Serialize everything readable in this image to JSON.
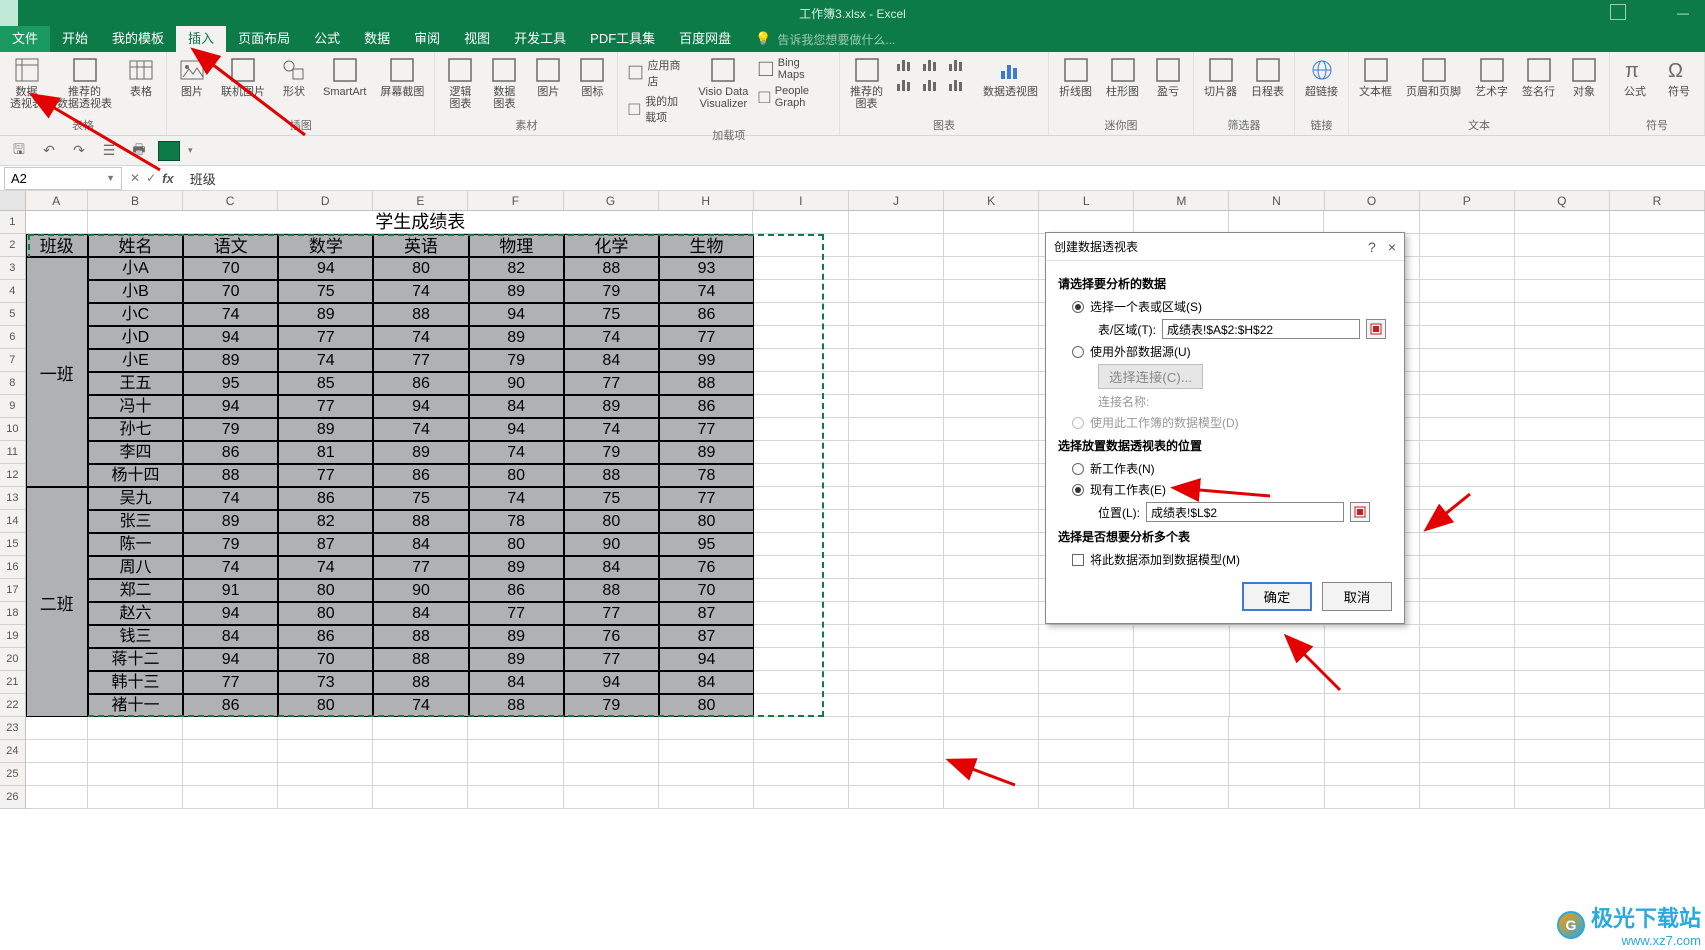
{
  "title_bar": {
    "doc": "工作簿3.xlsx - Excel"
  },
  "tabs": {
    "file": "文件",
    "items": [
      "开始",
      "我的模板",
      "插入",
      "页面布局",
      "公式",
      "数据",
      "审阅",
      "视图",
      "开发工具",
      "PDF工具集",
      "百度网盘"
    ],
    "active_index": 2,
    "tell_me": "告诉我您想要做什么..."
  },
  "ribbon": {
    "groups": [
      {
        "name": "表格",
        "btns": [
          {
            "label": "数据\n透视表",
            "icon": "pivot-table-icon"
          },
          {
            "label": "推荐的\n数据透视表",
            "icon": "recommended-pivot-icon"
          },
          {
            "label": "表格",
            "icon": "table-icon"
          }
        ]
      },
      {
        "name": "插图",
        "btns": [
          {
            "label": "图片",
            "icon": "picture-icon"
          },
          {
            "label": "联机图片",
            "icon": "online-picture-icon"
          },
          {
            "label": "形状",
            "icon": "shapes-icon"
          },
          {
            "label": "SmartArt",
            "icon": "smartart-icon"
          },
          {
            "label": "屏幕截图",
            "icon": "screenshot-icon"
          }
        ]
      },
      {
        "name": "素材",
        "btns": [
          {
            "label": "逻辑\n图表",
            "icon": "logic-chart-icon"
          },
          {
            "label": "数据\n图表",
            "icon": "data-chart-icon"
          },
          {
            "label": "图片",
            "icon": "pictures-icon"
          },
          {
            "label": "图标",
            "icon": "icons-icon"
          }
        ]
      },
      {
        "name": "加载项",
        "stack": [
          {
            "label": "应用商店",
            "icon": "store-icon"
          },
          {
            "label": "我的加载项",
            "icon": "addins-icon"
          }
        ],
        "btns": [
          {
            "label": "Visio Data\nVisualizer",
            "icon": "visio-icon"
          },
          {
            "label": "Bing Maps",
            "icon": "bing-maps-icon",
            "stackmode": true
          },
          {
            "label": "People Graph",
            "icon": "people-graph-icon",
            "stackmode": true
          }
        ]
      },
      {
        "name": "图表",
        "btns": [
          {
            "label": "推荐的\n图表",
            "icon": "recommended-chart-icon"
          },
          {
            "label": "",
            "icon": "chart-gallery-icon",
            "gallery": true
          },
          {
            "label": "数据透视图",
            "icon": "pivot-chart-icon"
          }
        ]
      },
      {
        "name": "迷你图",
        "btns": [
          {
            "label": "折线图",
            "icon": "sparkline-line-icon"
          },
          {
            "label": "柱形图",
            "icon": "sparkline-column-icon"
          },
          {
            "label": "盈亏",
            "icon": "sparkline-winloss-icon"
          }
        ]
      },
      {
        "name": "筛选器",
        "btns": [
          {
            "label": "切片器",
            "icon": "slicer-icon"
          },
          {
            "label": "日程表",
            "icon": "timeline-icon"
          }
        ]
      },
      {
        "name": "链接",
        "btns": [
          {
            "label": "超链接",
            "icon": "hyperlink-icon"
          }
        ]
      },
      {
        "name": "文本",
        "btns": [
          {
            "label": "文本框",
            "icon": "textbox-icon"
          },
          {
            "label": "页眉和页脚",
            "icon": "header-footer-icon"
          },
          {
            "label": "艺术字",
            "icon": "wordart-icon"
          },
          {
            "label": "签名行",
            "icon": "signature-icon"
          },
          {
            "label": "对象",
            "icon": "object-icon"
          }
        ]
      },
      {
        "name": "符号",
        "btns": [
          {
            "label": "公式",
            "icon": "equation-icon"
          },
          {
            "label": "符号",
            "icon": "symbol-icon"
          }
        ]
      }
    ]
  },
  "namebox": "A2",
  "formula": "班级",
  "columns": [
    "A",
    "B",
    "C",
    "D",
    "E",
    "F",
    "G",
    "H",
    "I",
    "J",
    "K",
    "L",
    "M",
    "N",
    "O",
    "P"
  ],
  "extra_cols": [
    "P",
    "Q",
    "R"
  ],
  "table": {
    "title": "学生成绩表",
    "headers": [
      "班级",
      "姓名",
      "语文",
      "数学",
      "英语",
      "物理",
      "化学",
      "生物"
    ],
    "class_merge": [
      {
        "label": "一班",
        "rows": 10
      },
      {
        "label": "二班",
        "rows": 10
      }
    ],
    "rows": [
      [
        "小A",
        "70",
        "94",
        "80",
        "82",
        "88",
        "93"
      ],
      [
        "小B",
        "70",
        "75",
        "74",
        "89",
        "79",
        "74"
      ],
      [
        "小C",
        "74",
        "89",
        "88",
        "94",
        "75",
        "86"
      ],
      [
        "小D",
        "94",
        "77",
        "74",
        "89",
        "74",
        "77"
      ],
      [
        "小E",
        "89",
        "74",
        "77",
        "79",
        "84",
        "99"
      ],
      [
        "王五",
        "95",
        "85",
        "86",
        "90",
        "77",
        "88"
      ],
      [
        "冯十",
        "94",
        "77",
        "94",
        "84",
        "89",
        "86"
      ],
      [
        "孙七",
        "79",
        "89",
        "74",
        "94",
        "74",
        "77"
      ],
      [
        "李四",
        "86",
        "81",
        "89",
        "74",
        "79",
        "89"
      ],
      [
        "杨十四",
        "88",
        "77",
        "86",
        "80",
        "88",
        "78"
      ],
      [
        "吴九",
        "74",
        "86",
        "75",
        "74",
        "75",
        "77"
      ],
      [
        "张三",
        "89",
        "82",
        "88",
        "78",
        "80",
        "80"
      ],
      [
        "陈一",
        "79",
        "87",
        "84",
        "80",
        "90",
        "95"
      ],
      [
        "周八",
        "74",
        "74",
        "77",
        "89",
        "84",
        "76"
      ],
      [
        "郑二",
        "91",
        "80",
        "90",
        "86",
        "88",
        "70"
      ],
      [
        "赵六",
        "94",
        "80",
        "84",
        "77",
        "77",
        "87"
      ],
      [
        "钱三",
        "84",
        "86",
        "88",
        "89",
        "76",
        "87"
      ],
      [
        "蒋十二",
        "94",
        "70",
        "88",
        "89",
        "77",
        "94"
      ],
      [
        "韩十三",
        "77",
        "73",
        "88",
        "84",
        "94",
        "84"
      ],
      [
        "褚十一",
        "86",
        "80",
        "74",
        "88",
        "79",
        "80"
      ]
    ]
  },
  "dialog": {
    "title": "创建数据透视表",
    "help": "?",
    "close": "×",
    "sect1": "请选择要分析的数据",
    "opt_table": "选择一个表或区域(S)",
    "lbl_range": "表/区域(T):",
    "range_val": "成绩表!$A$2:$H$22",
    "opt_ext": "使用外部数据源(U)",
    "btn_conn": "选择连接(C)...",
    "lbl_connname": "连接名称:",
    "opt_model": "使用此工作簿的数据模型(D)",
    "sect2": "选择放置数据透视表的位置",
    "opt_new": "新工作表(N)",
    "opt_exist": "现有工作表(E)",
    "lbl_loc": "位置(L):",
    "loc_val": "成绩表!$L$2",
    "sect3": "选择是否想要分析多个表",
    "chk_add": "将此数据添加到数据模型(M)",
    "ok": "确定",
    "cancel": "取消"
  },
  "watermark": {
    "brand": "极光下载站",
    "url": "www.xz7.com"
  }
}
